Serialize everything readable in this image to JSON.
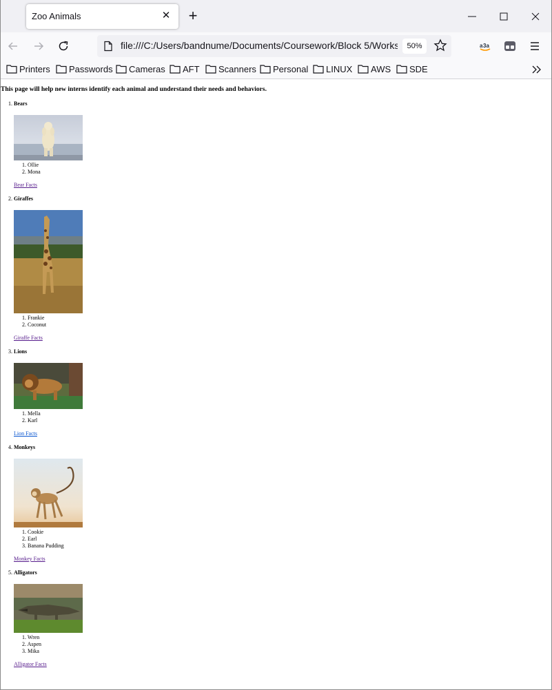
{
  "browser": {
    "tab_title": "Zoo Animals",
    "url": "file:///C:/Users/bandnume/Documents/Coursework/Block 5/Works",
    "zoom": "50%",
    "bookmarks": [
      "Printers",
      "Passwords",
      "Cameras",
      "AFT",
      "Scanners",
      "Personal",
      "LINUX",
      "AWS",
      "SDE"
    ]
  },
  "page": {
    "intro": "This page will help new interns identify each animal and understand their needs and behaviors.",
    "animals": [
      {
        "number": "1.",
        "title": "Bears",
        "names": [
          "Ollie",
          "Mona"
        ],
        "name_numbers": [
          "1.",
          "2."
        ],
        "link": "Bear Facts"
      },
      {
        "number": "2.",
        "title": "Giraffes",
        "names": [
          "Frankie",
          "Coconut"
        ],
        "name_numbers": [
          "1.",
          "2."
        ],
        "link": "Giraffe Facts"
      },
      {
        "number": "3.",
        "title": "Lions",
        "names": [
          "Mella",
          "Karl"
        ],
        "name_numbers": [
          "1.",
          "2."
        ],
        "link": "Lion Facts"
      },
      {
        "number": "4.",
        "title": "Monkeys",
        "names": [
          "Cookie",
          "Earl",
          "Banana Pudding"
        ],
        "name_numbers": [
          "1.",
          "2.",
          "3."
        ],
        "link": "Monkey Facts"
      },
      {
        "number": "5.",
        "title": "Alligators",
        "names": [
          "Wren",
          "Aspen",
          "Mika"
        ],
        "name_numbers": [
          "1.",
          "2.",
          "3."
        ],
        "link": "Alligator Facts"
      }
    ]
  },
  "icons": {
    "back": "arrow-left-icon",
    "forward": "arrow-right-icon",
    "reload": "reload-icon",
    "page": "page-icon",
    "star": "star-icon",
    "menu": "hamburger-menu-icon",
    "folder": "folder-icon"
  },
  "colors": {
    "visited_link": "#551a8b",
    "unvisited_link": "#0b57d0",
    "chrome_bg": "#f0f0f4"
  }
}
